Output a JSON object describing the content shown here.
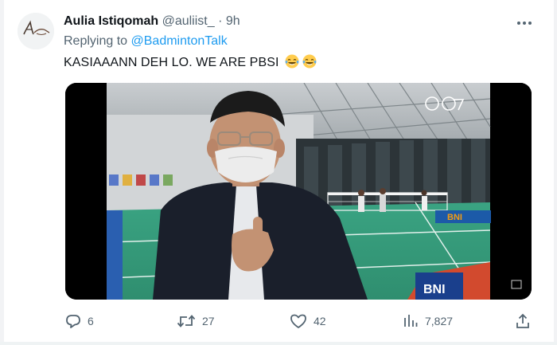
{
  "tweet": {
    "display_name": "Aulia Istiqomah",
    "handle": "@auliist_",
    "separator": "·",
    "time": "9h",
    "replying_prefix": "Replying to",
    "replying_to": "@BadmintonTalk",
    "text": "KASIAAANN DEH LO. WE ARE PBSI",
    "emojis": [
      "face-with-tears-of-joy-emoji",
      "face-with-tears-of-joy-emoji"
    ],
    "avatar_icon": "avatar-logo",
    "media": {
      "type": "video",
      "content": "man in dark jacket and face mask gesturing in badminton hall",
      "court_banner": "BNI"
    },
    "actions": {
      "replies": "6",
      "retweets": "27",
      "likes": "42",
      "views": "7,827"
    }
  },
  "icons": {
    "more": "more-icon",
    "reply": "reply-icon",
    "retweet": "retweet-icon",
    "like": "heart-icon",
    "views": "views-icon",
    "share": "share-icon"
  },
  "colors": {
    "link": "#1d9bf0",
    "secondary_text": "#536471",
    "primary_text": "#0f1419"
  }
}
